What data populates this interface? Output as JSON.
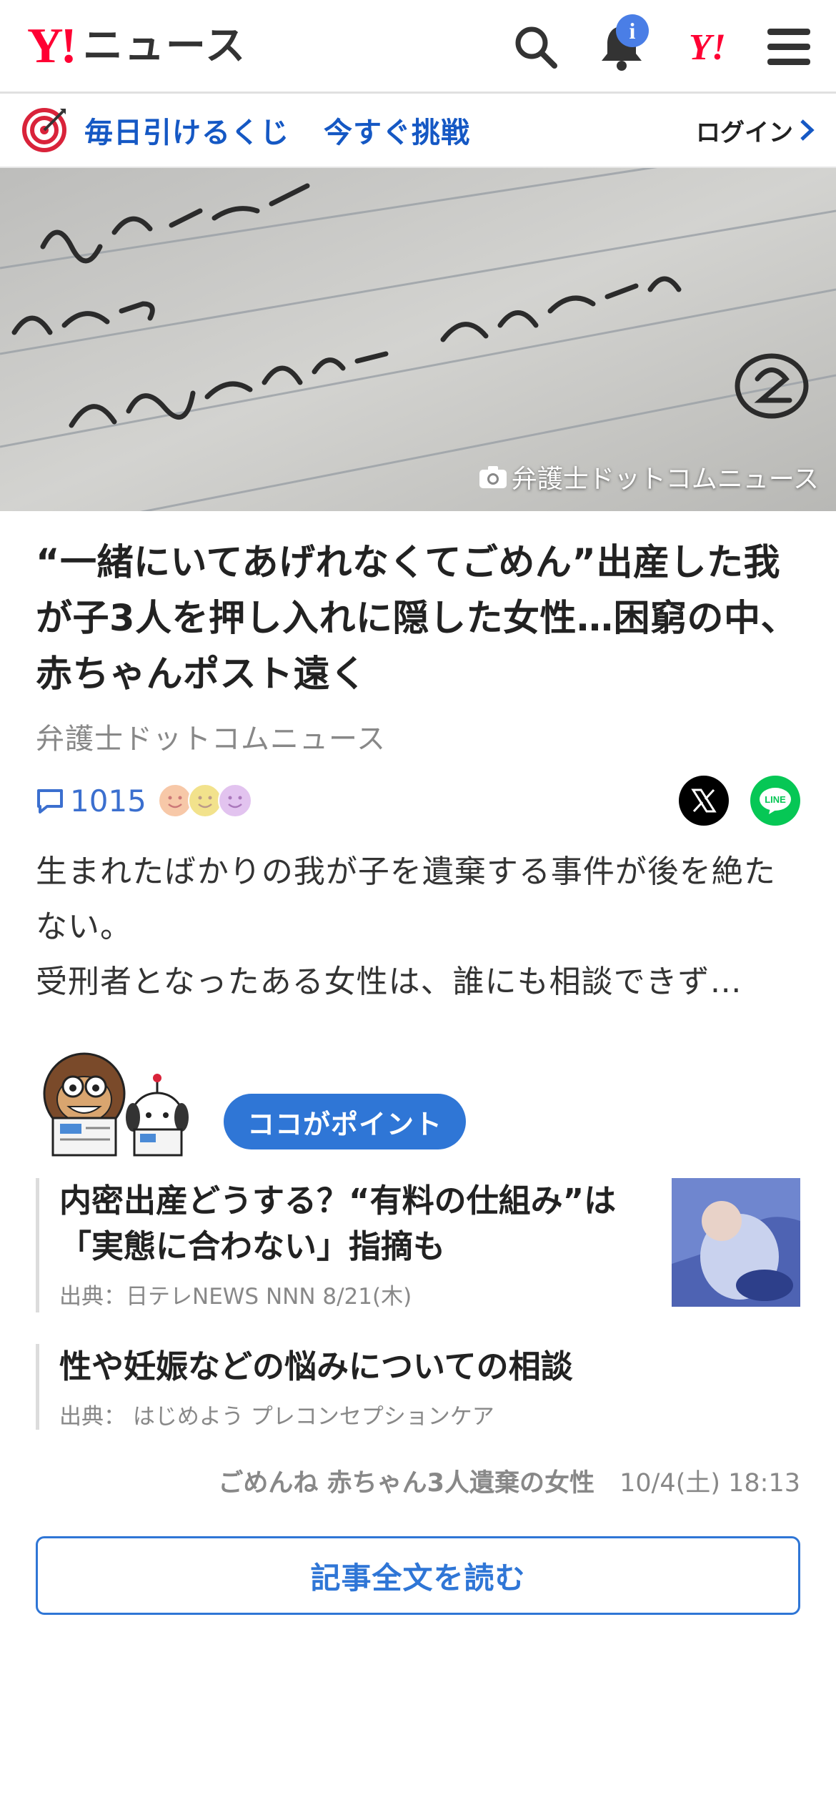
{
  "header": {
    "logo_mark": "Y!",
    "logo_text": "ニュース",
    "notification_badge": "i",
    "yahoo_mark": "Y!"
  },
  "promo": {
    "text1": "毎日引けるくじ",
    "text2": "今すぐ挑戦",
    "login_label": "ログイン"
  },
  "hero": {
    "photo_credit": "弁護士ドットコムニュース"
  },
  "article": {
    "title": "“一緒にいてあげれなくてごめん”出産した我が子3人を押し入れに隠した女性…困窮の中、赤ちゃんポスト遠く",
    "source": "弁護士ドットコムニュース",
    "comment_count": "1015",
    "lead_1": "生まれたばかりの我が子を遺棄する事件が後を絶たない。",
    "lead_2": "受刑者となったある女性は、誰にも相談できず…"
  },
  "points": {
    "label": "ココがポイント",
    "items": [
      {
        "title": "内密出産どうする？“有料の仕組み”は「実態に合わない」指摘も",
        "source": "出典：日テレNEWS NNN 8/21(木)"
      },
      {
        "title": "性や妊娠などの悩みについての相談",
        "source": "出典： はじめよう プレコンセプションケア"
      }
    ]
  },
  "footer": {
    "topic": "ごめんね 赤ちゃん3人遺棄の女性",
    "datetime": "10/4(土) 18:13",
    "read_button": "記事全文を読む"
  },
  "colors": {
    "brand_red": "#ff0033",
    "link_blue": "#1558c4",
    "accent_blue": "#2f76d6",
    "line_green": "#06c755"
  }
}
